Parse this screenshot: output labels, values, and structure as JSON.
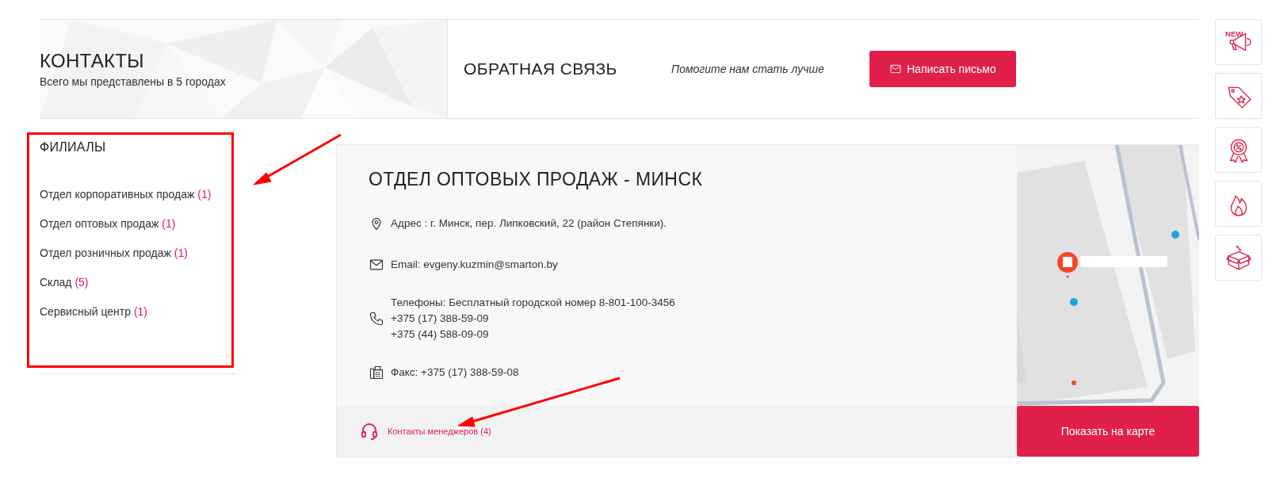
{
  "header": {
    "title": "КОНТАКТЫ",
    "subtitle": "Всего мы представлены в 5 городах"
  },
  "feedback": {
    "title": "ОБРАТНАЯ СВЯЗЬ",
    "tagline": "Помогите нам стать лучше",
    "button": "Написать письмо"
  },
  "branches": {
    "title": "ФИЛИАЛЫ",
    "items": [
      {
        "label": "Отдел корпоративных продаж",
        "count": "(1)"
      },
      {
        "label": "Отдел оптовых продаж",
        "count": "(1)"
      },
      {
        "label": "Отдел розничных продаж",
        "count": "(1)"
      },
      {
        "label": "Склад",
        "count": "(5)"
      },
      {
        "label": "Сервисный центр",
        "count": "(1)"
      }
    ]
  },
  "office": {
    "title": "ОТДЕЛ ОПТОВЫХ ПРОДАЖ - МИНСК",
    "details": [
      {
        "kind": "address",
        "lines": [
          "Адрес : г. Минск, пер. Липковский, 22 (район Степянки)."
        ]
      },
      {
        "kind": "email",
        "lines": [
          "Email: evgeny.kuzmin@smarton.by"
        ]
      },
      {
        "kind": "phone",
        "lines": [
          "Телефоны: Бесплатный городской номер 8-801-100-3456",
          "+375 (17) 388-59-09",
          "+375 (44) 588-09-09"
        ]
      },
      {
        "kind": "fax",
        "lines": [
          "Факс: +375 (17) 388-59-08"
        ]
      }
    ],
    "managers_link": "Контакты менеджеров (4)",
    "map_button": "Показать на карте"
  },
  "side_icons": [
    {
      "kind": "megaphone",
      "label": "NEW"
    },
    {
      "kind": "tag"
    },
    {
      "kind": "award"
    },
    {
      "kind": "flame"
    },
    {
      "kind": "box"
    }
  ]
}
